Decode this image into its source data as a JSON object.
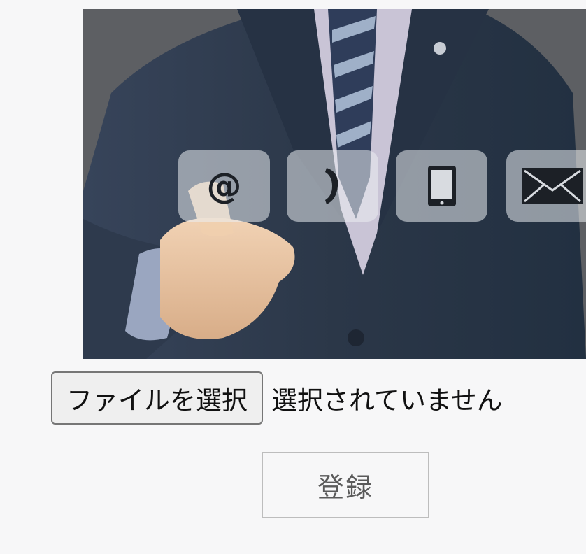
{
  "photo": {
    "icons": [
      "at-sign-icon",
      "phone-icon",
      "mobile-icon",
      "envelope-icon"
    ],
    "at_symbol": "@"
  },
  "file_input": {
    "button_label": "ファイルを選択",
    "status_text": "選択されていません"
  },
  "form": {
    "submit_label": "登録"
  },
  "colors": {
    "page_background": "#f7f7f8",
    "suit": "#2a3646",
    "button_border": "#767676",
    "submit_border": "#bdbdbd"
  }
}
